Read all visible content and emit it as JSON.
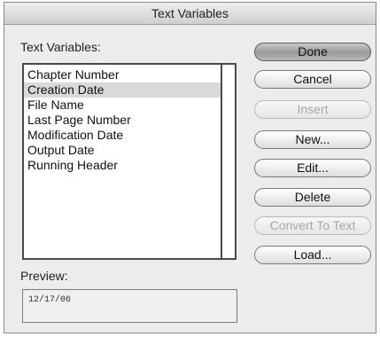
{
  "dialog": {
    "title": "Text Variables"
  },
  "list": {
    "label": "Text Variables:",
    "items": [
      "Chapter Number",
      "Creation Date",
      "File Name",
      "Last Page Number",
      "Modification Date",
      "Output Date",
      "Running Header"
    ],
    "selected_index": 1
  },
  "preview": {
    "label": "Preview:",
    "value": "12/17/06"
  },
  "buttons": {
    "done": "Done",
    "cancel": "Cancel",
    "insert": "Insert",
    "new": "New...",
    "edit": "Edit...",
    "delete": "Delete",
    "convert": "Convert To Text",
    "load": "Load..."
  },
  "states": {
    "insert_enabled": false,
    "convert_enabled": false
  }
}
